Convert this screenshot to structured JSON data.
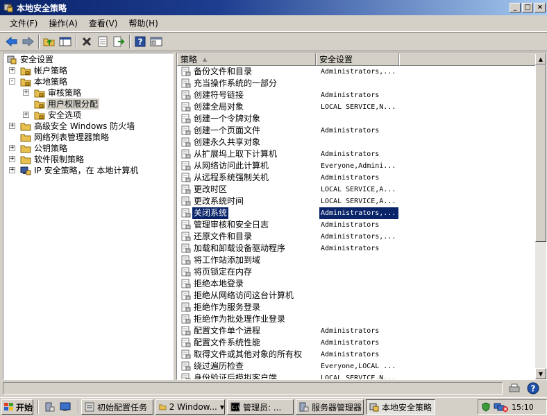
{
  "window": {
    "title": "本地安全策略",
    "min_symbol": "_",
    "max_symbol": "□",
    "close_symbol": "×"
  },
  "menu": {
    "items": [
      "文件(F)",
      "操作(A)",
      "查看(V)",
      "帮助(H)"
    ]
  },
  "toolbar": {
    "icons": [
      "back-arrow-icon",
      "forward-arrow-icon",
      "up-folder-icon",
      "show-tree-icon",
      "delete-icon",
      "properties-icon",
      "export-icon",
      "help-icon",
      "console-icon"
    ]
  },
  "tree": {
    "items": [
      {
        "label": "安全设置",
        "level": 0,
        "expander": ""
      },
      {
        "label": "帐户策略",
        "level": 1,
        "expander": "+"
      },
      {
        "label": "本地策略",
        "level": 1,
        "expander": "-"
      },
      {
        "label": "审核策略",
        "level": 2,
        "expander": "+"
      },
      {
        "label": "用户权限分配",
        "level": 2,
        "expander": ""
      },
      {
        "label": "安全选项",
        "level": 2,
        "expander": "+"
      },
      {
        "label": "高级安全 Windows 防火墙",
        "level": 1,
        "expander": "+"
      },
      {
        "label": "网络列表管理器策略",
        "level": 1,
        "expander": ""
      },
      {
        "label": "公钥策略",
        "level": 1,
        "expander": "+"
      },
      {
        "label": "软件限制策略",
        "level": 1,
        "expander": "+"
      },
      {
        "label": "IP 安全策略，在 本地计算机",
        "level": 1,
        "expander": "+"
      }
    ],
    "selected_index": 4
  },
  "list": {
    "headers": {
      "policy": "策略",
      "setting": "安全设置"
    },
    "sort_indicator": "▲",
    "rows": [
      {
        "name": "备份文件和目录",
        "value": "Administrators,..."
      },
      {
        "name": "充当操作系统的一部分",
        "value": ""
      },
      {
        "name": "创建符号链接",
        "value": "Administrators"
      },
      {
        "name": "创建全局对象",
        "value": "LOCAL SERVICE,N..."
      },
      {
        "name": "创建一个令牌对象",
        "value": ""
      },
      {
        "name": "创建一个页面文件",
        "value": "Administrators"
      },
      {
        "name": "创建永久共享对象",
        "value": ""
      },
      {
        "name": "从扩展坞上取下计算机",
        "value": "Administrators"
      },
      {
        "name": "从网络访问此计算机",
        "value": "Everyone,Admini..."
      },
      {
        "name": "从远程系统强制关机",
        "value": "Administrators"
      },
      {
        "name": "更改时区",
        "value": "LOCAL SERVICE,A..."
      },
      {
        "name": "更改系统时间",
        "value": "LOCAL SERVICE,A..."
      },
      {
        "name": "关闭系统",
        "value": "Administrators,..."
      },
      {
        "name": "管理审核和安全日志",
        "value": "Administrators"
      },
      {
        "name": "还原文件和目录",
        "value": "Administrators,..."
      },
      {
        "name": "加载和卸载设备驱动程序",
        "value": "Administrators"
      },
      {
        "name": "将工作站添加到域",
        "value": ""
      },
      {
        "name": "将页锁定在内存",
        "value": ""
      },
      {
        "name": "拒绝本地登录",
        "value": ""
      },
      {
        "name": "拒绝从网络访问这台计算机",
        "value": ""
      },
      {
        "name": "拒绝作为服务登录",
        "value": ""
      },
      {
        "name": "拒绝作为批处理作业登录",
        "value": ""
      },
      {
        "name": "配置文件单个进程",
        "value": "Administrators"
      },
      {
        "name": "配置文件系统性能",
        "value": "Administrators"
      },
      {
        "name": "取得文件或其他对象的所有权",
        "value": "Administrators"
      },
      {
        "name": "绕过遍历检查",
        "value": "Everyone,LOCAL ..."
      },
      {
        "name": "身份验证后模拟客户端",
        "value": "LOCAL SERVICE,N..."
      }
    ],
    "selected_index": 12
  },
  "taskbar": {
    "start_label": "开始",
    "tasks": [
      {
        "label": "初始配置任务",
        "active": false
      },
      {
        "label": "2 Window...",
        "active": false,
        "dropdown": "▼"
      },
      {
        "label": "管理员: ...",
        "active": false
      },
      {
        "label": "服务器管理器",
        "active": false
      },
      {
        "label": "本地安全策略",
        "active": true
      }
    ],
    "clock": "15:10"
  },
  "colors": {
    "title_start": "#0a246a",
    "title_end": "#a6caf0",
    "selection": "#0a246a",
    "face": "#d4d0c8"
  }
}
